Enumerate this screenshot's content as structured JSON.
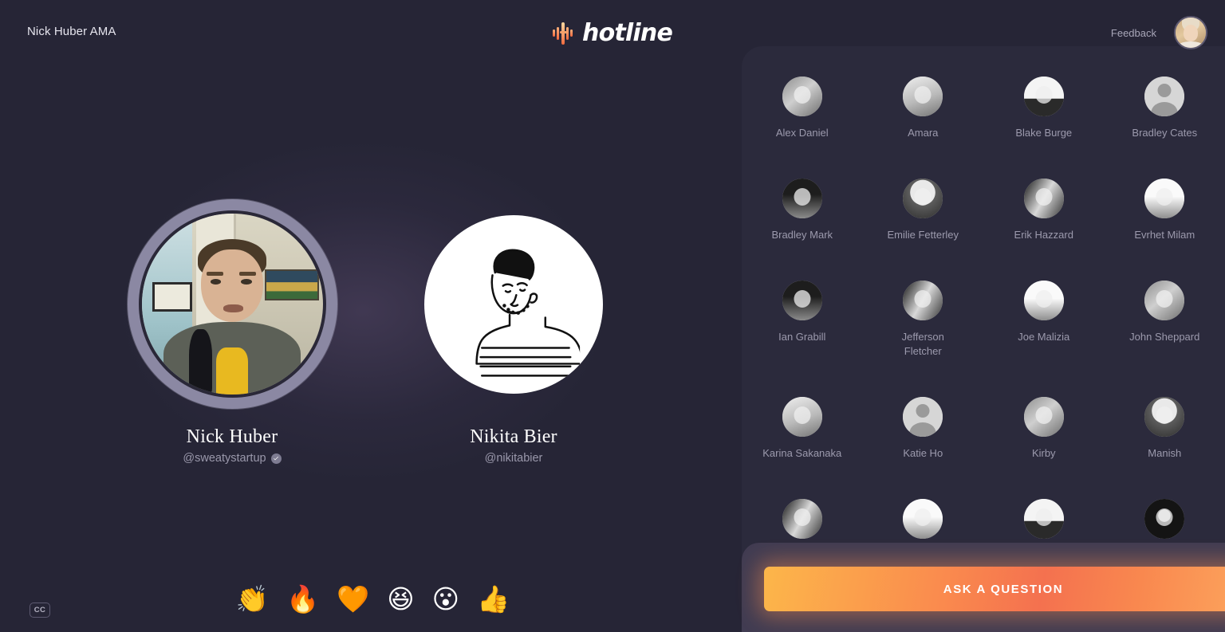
{
  "header": {
    "room_title": "Nick Huber AMA",
    "brand_name": "hotline",
    "brand_icon": "waveform-icon",
    "feedback_label": "Feedback",
    "avatar_name": "user-avatar"
  },
  "stage": {
    "speakers": [
      {
        "name": "Nick Huber",
        "handle": "@sweatystartup",
        "verified": true,
        "active": true,
        "avatar_kind": "webcam"
      },
      {
        "name": "Nikita Bier",
        "handle": "@nikitabier",
        "verified": false,
        "active": false,
        "avatar_kind": "line-art"
      }
    ],
    "cc_label": "CC",
    "reactions": [
      "👏",
      "🔥",
      "🧡",
      "😆",
      "😮",
      "👍"
    ],
    "reaction_names": [
      "clap-reaction",
      "fire-reaction",
      "heart-reaction",
      "laugh-reaction",
      "surprised-reaction",
      "thumbs-up-reaction"
    ]
  },
  "people": {
    "list": [
      {
        "name": "Alex Daniel",
        "style": "av-a"
      },
      {
        "name": "Amara",
        "style": "av-b"
      },
      {
        "name": "Blake Burge",
        "style": "av-c"
      },
      {
        "name": "Bradley Cates",
        "style": "av-ph"
      },
      {
        "name": "Bradley Mark",
        "style": "av-d"
      },
      {
        "name": "Emilie Fetterley",
        "style": "av-e"
      },
      {
        "name": "Erik Hazzard",
        "style": "av-f"
      },
      {
        "name": "Evrhet Milam",
        "style": "av-g"
      },
      {
        "name": "Ian Grabill",
        "style": "av-d"
      },
      {
        "name": "Jefferson Fletcher",
        "style": "av-f"
      },
      {
        "name": "Joe Malizia",
        "style": "av-g"
      },
      {
        "name": "John Sheppard",
        "style": "av-a"
      },
      {
        "name": "Karina Sakanaka",
        "style": "av-b"
      },
      {
        "name": "Katie Ho",
        "style": "av-ph"
      },
      {
        "name": "Kirby",
        "style": "av-a"
      },
      {
        "name": "Manish",
        "style": "av-e"
      },
      {
        "name": "",
        "style": "av-f"
      },
      {
        "name": "",
        "style": "av-g"
      },
      {
        "name": "",
        "style": "av-c"
      },
      {
        "name": "",
        "style": "av-dv"
      }
    ]
  },
  "footer": {
    "ask_label": "ASK A QUESTION"
  },
  "colors": {
    "background": "#262536",
    "panel": "#2b2a3c",
    "cta_panel": "#413c52",
    "accent_start": "#fcb64a",
    "accent_end": "#fca35c",
    "muted_text": "#9c9aad",
    "brand_icon": "#f5a06a"
  }
}
